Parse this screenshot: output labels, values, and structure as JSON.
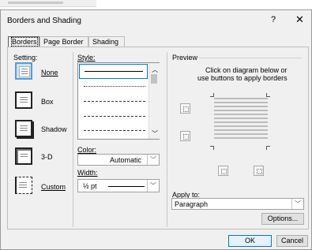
{
  "dialog": {
    "title": "Borders and Shading",
    "help": "?",
    "close": "✕"
  },
  "tabs": [
    {
      "label": "Borders",
      "active": true
    },
    {
      "label": "Page Border",
      "active": false
    },
    {
      "label": "Shading",
      "active": false
    }
  ],
  "setting": {
    "label": "Setting:",
    "options": [
      {
        "label": "None",
        "icon": "none-setting-icon",
        "selected": true
      },
      {
        "label": "Box",
        "icon": "box-setting-icon"
      },
      {
        "label": "Shadow",
        "icon": "shadow-setting-icon"
      },
      {
        "label": "3-D",
        "icon": "3d-setting-icon"
      },
      {
        "label": "Custom",
        "icon": "custom-setting-icon"
      }
    ]
  },
  "style": {
    "label": "Style:"
  },
  "color": {
    "label": "Color:",
    "value": "Automatic"
  },
  "width": {
    "label": "Width:",
    "value": "½ pt"
  },
  "preview": {
    "label": "Preview",
    "instruction_line1": "Click on diagram below or",
    "instruction_line2": "use buttons to apply borders"
  },
  "apply_to": {
    "label": "Apply to:",
    "value": "Paragraph"
  },
  "buttons": {
    "options": "Options...",
    "ok": "OK",
    "cancel": "Cancel"
  },
  "colors": {
    "accent": "#0078d7",
    "dialog_bg": "#f0f0f0"
  }
}
